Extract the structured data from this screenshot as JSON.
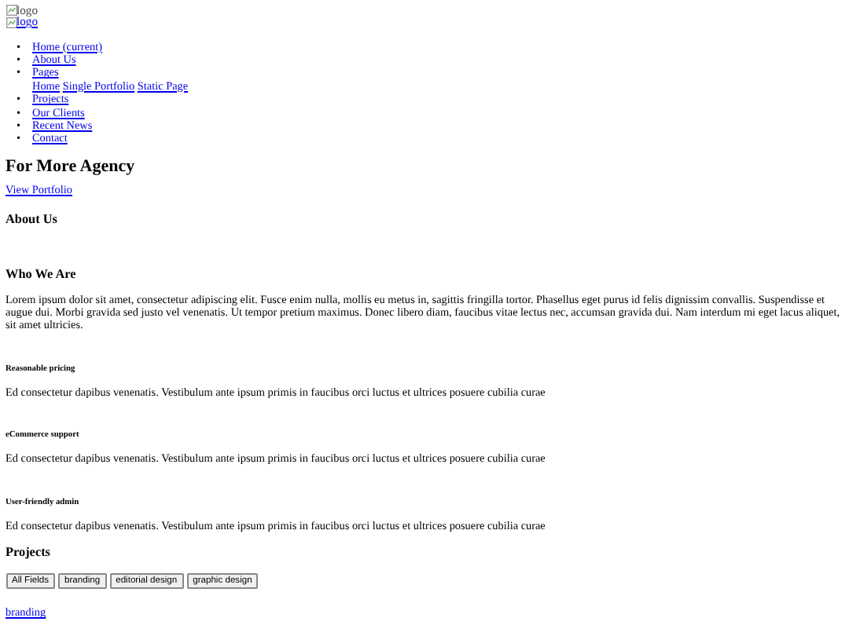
{
  "logos": [
    {
      "alt": "logo",
      "kind": "image"
    },
    {
      "alt": "logo",
      "kind": "link"
    }
  ],
  "nav": [
    {
      "marker": "•",
      "label": "Home (current)"
    },
    {
      "marker": "•",
      "label": "About Us"
    },
    {
      "marker": "•",
      "label": "Pages",
      "children": [
        {
          "label": "Home"
        },
        {
          "label": "Single Portfolio"
        },
        {
          "label": "Static Page"
        }
      ]
    },
    {
      "marker": "•",
      "label": "Projects"
    },
    {
      "marker": "•",
      "label": "Our Clients"
    },
    {
      "marker": "•",
      "label": "Recent News"
    },
    {
      "marker": "•",
      "label": "Contact"
    }
  ],
  "hero": {
    "title": "For More Agency",
    "link": "View Portfolio"
  },
  "about": {
    "heading": "About Us",
    "subheading": "Who We Are",
    "text": "Lorem ipsum dolor sit amet, consectetur adipiscing elit. Fusce enim nulla, mollis eu metus in, sagittis fringilla tortor. Phasellus eget purus id felis dignissim convallis. Suspendisse et augue dui. Morbi gravida sed justo vel venenatis. Ut tempor pretium maximus. Donec libero diam, faucibus vitae lectus nec, accumsan gravida dui. Nam interdum mi eget lacus aliquet, sit amet ultricies."
  },
  "features": [
    {
      "title": "Reasonable pricing",
      "text": "Ed consectetur dapibus venenatis. Vestibulum ante ipsum primis in faucibus orci luctus et ultrices posuere cubilia curae"
    },
    {
      "title": "eCommerce support",
      "text": "Ed consectetur dapibus venenatis. Vestibulum ante ipsum primis in faucibus orci luctus et ultrices posuere cubilia curae"
    },
    {
      "title": "User-friendly admin",
      "text": "Ed consectetur dapibus venenatis. Vestibulum ante ipsum primis in faucibus orci luctus et ultrices posuere cubilia curae"
    }
  ],
  "projects": {
    "heading": "Projects",
    "filters": [
      "All Fields",
      "branding",
      "editorial design",
      "graphic design"
    ],
    "items": [
      {
        "link": "branding"
      }
    ]
  }
}
